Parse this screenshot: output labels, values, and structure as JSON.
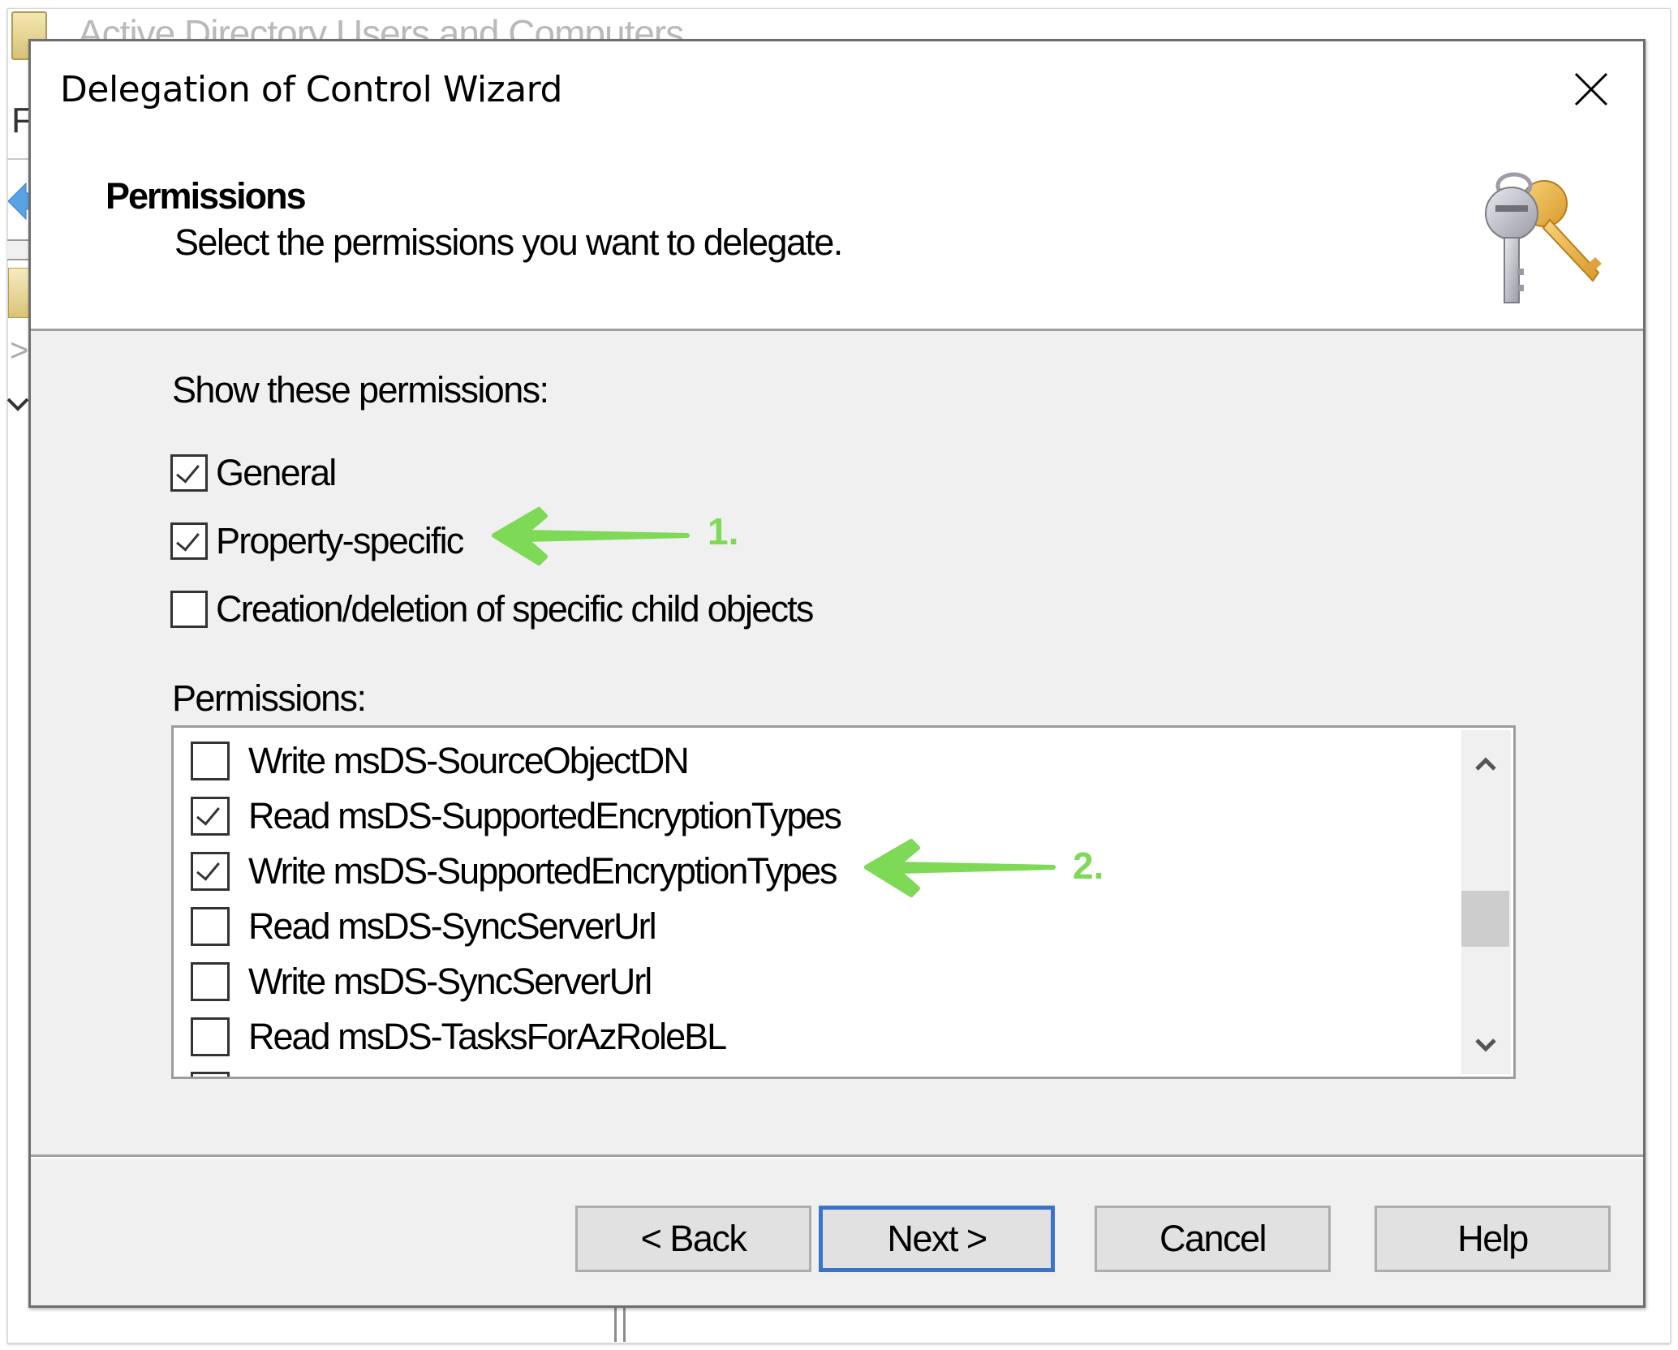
{
  "background_window": {
    "title": "Active Directory Users and Computers",
    "menu_letter": "F",
    "expand_glyph": ">",
    "collapse_glyph": "v"
  },
  "dialog": {
    "title": "Delegation of Control Wizard",
    "close_icon": "close-icon",
    "page_heading": "Permissions",
    "page_subtitle": "Select the permissions you want to delegate.",
    "header_icon": "keys-icon",
    "show_label": "Show these permissions:",
    "show_options": [
      {
        "label": "General",
        "checked": true
      },
      {
        "label": "Property-specific",
        "checked": true
      },
      {
        "label": "Creation/deletion of specific child objects",
        "checked": false
      }
    ],
    "permissions_label": "Permissions:",
    "permissions": [
      {
        "label": "Write msDS-SourceObjectDN",
        "checked": false
      },
      {
        "label": "Read msDS-SupportedEncryptionTypes",
        "checked": true
      },
      {
        "label": "Write msDS-SupportedEncryptionTypes",
        "checked": true
      },
      {
        "label": "Read msDS-SyncServerUrl",
        "checked": false
      },
      {
        "label": "Write msDS-SyncServerUrl",
        "checked": false
      },
      {
        "label": "Read msDS-TasksForAzRoleBL",
        "checked": false
      },
      {
        "label": "",
        "checked": false
      }
    ],
    "scroll_position_fraction": 0.52,
    "buttons": {
      "back": "< Back",
      "next": "Next >",
      "cancel": "Cancel",
      "help": "Help"
    },
    "default_button": "next"
  },
  "annotations": [
    {
      "label": "1.",
      "target": "Property-specific",
      "color": "#7ed957"
    },
    {
      "label": "2.",
      "target": "Write msDS-SupportedEncryptionTypes",
      "color": "#7ed957"
    }
  ]
}
